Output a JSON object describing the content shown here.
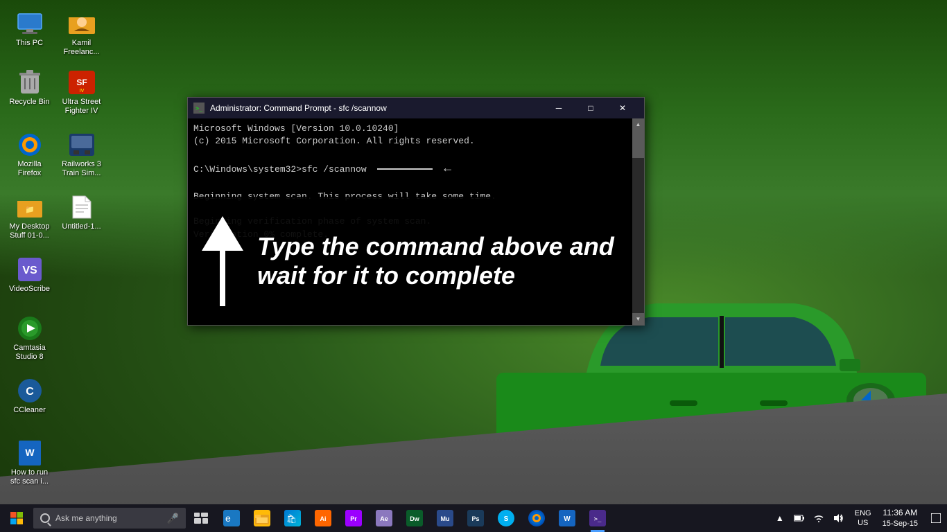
{
  "desktop": {
    "icons": [
      {
        "id": "thispc",
        "label": "This PC",
        "type": "monitor"
      },
      {
        "id": "kamil",
        "label": "Kamil Freelanc...",
        "type": "folder-person"
      },
      {
        "id": "recycle",
        "label": "Recycle Bin",
        "type": "recyclebin"
      },
      {
        "id": "ultra",
        "label": "Ultra Street Fighter IV",
        "type": "gamepad"
      },
      {
        "id": "firefox",
        "label": "Mozilla Firefox",
        "type": "firefox"
      },
      {
        "id": "railworks",
        "label": "Railworks 3 Train Sim...",
        "type": "train"
      },
      {
        "id": "mydesktop",
        "label": "My Desktop Stuff 01-0...",
        "type": "folder"
      },
      {
        "id": "untitled",
        "label": "Untitled-1...",
        "type": "doc"
      },
      {
        "id": "videoscribe",
        "label": "VideoScribe",
        "type": "vs"
      },
      {
        "id": "camtasia",
        "label": "Camtasia Studio 8",
        "type": "camtasia"
      },
      {
        "id": "ccleaner",
        "label": "CCleaner",
        "type": "ccleaner"
      },
      {
        "id": "howto",
        "label": "How to run sfc scan i...",
        "type": "worddoc"
      }
    ]
  },
  "cmd_window": {
    "title": "Administrator: Command Prompt - sfc  /scannow",
    "lines": [
      "Microsoft Windows [Version 10.0.10240]",
      "(c) 2015 Microsoft Corporation. All rights reserved.",
      "",
      "C:\\Windows\\system32>sfc /scannow",
      "",
      "Beginning system scan.  This process will take some time.",
      "",
      "Beginning verification phase of system scan.",
      "Verification 0% complete."
    ],
    "command_line": "C:\\Windows\\system32>sfc /scannow",
    "controls": {
      "minimize": "─",
      "maximize": "□",
      "close": "✕"
    }
  },
  "overlay": {
    "text": "Type the command above and wait for it to complete"
  },
  "taskbar": {
    "search_placeholder": "Ask me anything",
    "apps": [
      {
        "id": "edge",
        "label": "Microsoft Edge",
        "color": "#1a78c2",
        "letter": "e"
      },
      {
        "id": "explorer",
        "label": "File Explorer",
        "color": "#ffba08",
        "letter": "📁"
      },
      {
        "id": "store",
        "label": "Windows Store",
        "color": "#0078d4",
        "letter": "🛍"
      },
      {
        "id": "ai",
        "label": "Adobe Illustrator",
        "color": "#ff6600",
        "letter": "Ai"
      },
      {
        "id": "premiere",
        "label": "Adobe Premiere",
        "color": "#9b00ff",
        "letter": "Pr"
      },
      {
        "id": "ae",
        "label": "Adobe After Effects",
        "color": "#8b78be",
        "letter": "Ae"
      },
      {
        "id": "dw",
        "label": "Adobe Dreamweaver",
        "color": "#0a5c2a",
        "letter": "Dw"
      },
      {
        "id": "mu",
        "label": "Adobe Muse",
        "color": "#2a4a8a",
        "letter": "Mu"
      },
      {
        "id": "ps",
        "label": "Adobe Photoshop",
        "color": "#1a3a5a",
        "letter": "Ps"
      },
      {
        "id": "skype",
        "label": "Skype",
        "color": "#00aff0",
        "letter": "S"
      },
      {
        "id": "firefox",
        "label": "Mozilla Firefox",
        "color": "#003399",
        "letter": "🦊"
      },
      {
        "id": "word",
        "label": "Microsoft Word",
        "color": "#1565c0",
        "letter": "W"
      },
      {
        "id": "cmd",
        "label": "Command Prompt",
        "color": "#4a2a8a",
        "letter": "C>"
      }
    ],
    "tray": {
      "lang": "ENG",
      "locale": "US",
      "time": "11:36 AM",
      "date": "15-Sep-15"
    }
  }
}
